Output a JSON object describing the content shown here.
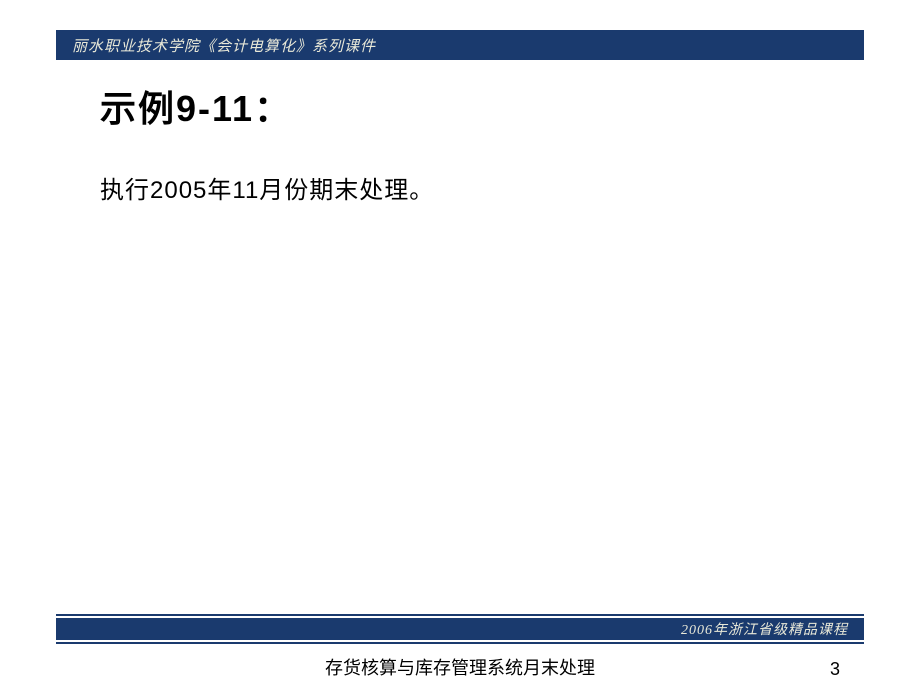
{
  "header": {
    "text": "丽水职业技术学院《会计电算化》系列课件"
  },
  "content": {
    "title": "示例9-11：",
    "body": "执行2005年11月份期末处理。"
  },
  "footer": {
    "text": "2006年浙江省级精品课程"
  },
  "caption": "存货核算与库存管理系统月末处理",
  "page_number": "3"
}
